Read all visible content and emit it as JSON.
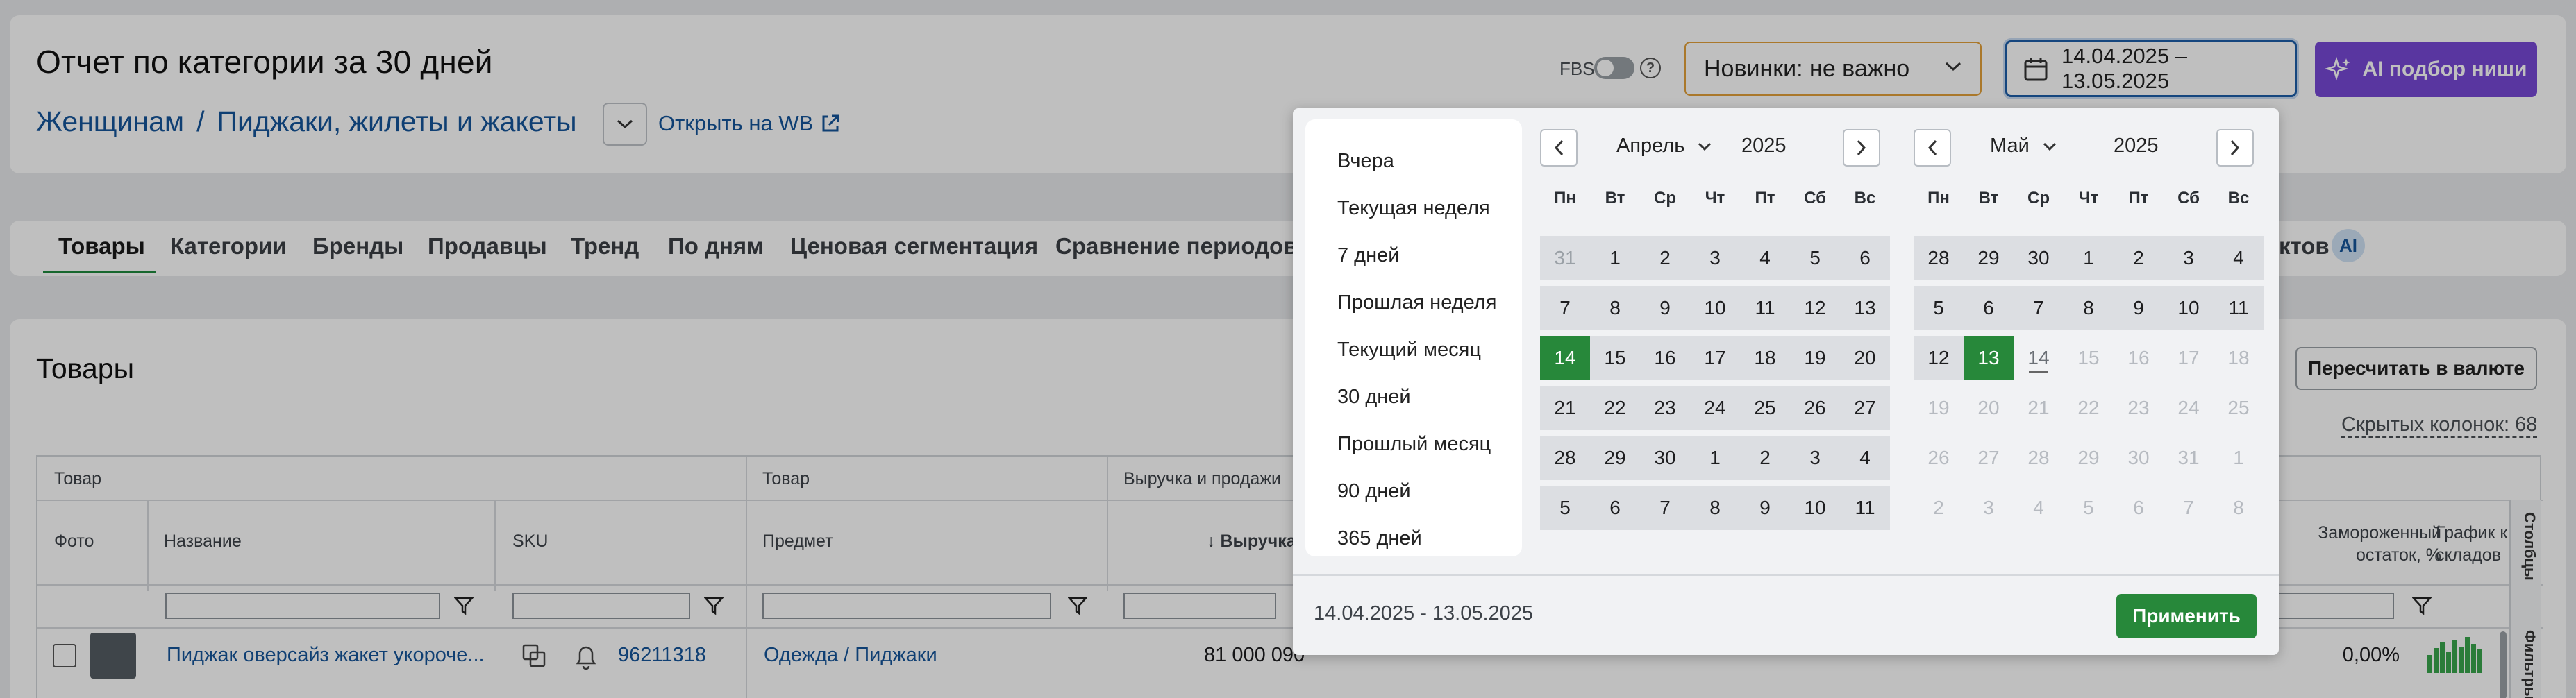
{
  "header": {
    "title": "Отчет по категории за 30 дней",
    "breadcrumb": [
      "Женщинам",
      "Пиджаки, жилеты и жакеты"
    ],
    "breadcrumb_sep": "/",
    "open_wb": "Открыть на WB",
    "fbs_label": "FBS",
    "fbs_help": "?",
    "novinki": "Новинки: не важно",
    "date_range": "14.04.2025 – 13.05.2025",
    "ai_button": "AI подбор ниши"
  },
  "tabs": [
    "Товары",
    "Категории",
    "Бренды",
    "Продавцы",
    "Тренд",
    "По дням",
    "Ценовая сегментация",
    "Сравнение периодов"
  ],
  "tab_overflow": {
    "label": "ктов",
    "badge": "AI"
  },
  "section": {
    "title": "Товары",
    "recalc": "Пересчитать в валюте",
    "hidden_cols": "Скрытых колонок: 68"
  },
  "table": {
    "groups": [
      "Товар",
      "Товар",
      "Выручка и продажи"
    ],
    "columns": [
      "Фото",
      "Название",
      "SKU",
      "Предмет",
      "↓ Выручка"
    ],
    "right_columns": [
      "Замороженный остаток, %",
      "График к складов"
    ],
    "side_tabs": [
      "Столбцы",
      "Фильтры"
    ],
    "row": {
      "name": "Пиджак оверсайз жакет укороче...",
      "sku": "96211318",
      "subject": "Одежда / Пиджаки",
      "revenue": "81 000 090",
      "frozen": "0,00%"
    }
  },
  "date_popup": {
    "presets": [
      "Вчера",
      "Текущая неделя",
      "7 дней",
      "Прошлая неделя",
      "Текущий месяц",
      "30 дней",
      "Прошлый месяц",
      "90 дней",
      "365 дней"
    ],
    "weekdays": [
      "Пн",
      "Вт",
      "Ср",
      "Чт",
      "Пт",
      "Сб",
      "Вс"
    ],
    "left": {
      "month": "Апрель",
      "year": "2025",
      "weeks": [
        [
          "31",
          "1",
          "2",
          "3",
          "4",
          "5",
          "6"
        ],
        [
          "7",
          "8",
          "9",
          "10",
          "11",
          "12",
          "13"
        ],
        [
          "14",
          "15",
          "16",
          "17",
          "18",
          "19",
          "20"
        ],
        [
          "21",
          "22",
          "23",
          "24",
          "25",
          "26",
          "27"
        ],
        [
          "28",
          "29",
          "30",
          "1",
          "2",
          "3",
          "4"
        ],
        [
          "5",
          "6",
          "7",
          "8",
          "9",
          "10",
          "11"
        ]
      ]
    },
    "right": {
      "month": "Май",
      "year": "2025",
      "weeks": [
        [
          "28",
          "29",
          "30",
          "1",
          "2",
          "3",
          "4"
        ],
        [
          "5",
          "6",
          "7",
          "8",
          "9",
          "10",
          "11"
        ],
        [
          "12",
          "13",
          "14",
          "15",
          "16",
          "17",
          "18"
        ],
        [
          "19",
          "20",
          "21",
          "22",
          "23",
          "24",
          "25"
        ],
        [
          "26",
          "27",
          "28",
          "29",
          "30",
          "31",
          "1"
        ],
        [
          "2",
          "3",
          "4",
          "5",
          "6",
          "7",
          "8"
        ]
      ]
    },
    "selected_range_text": "14.04.2025 - 13.05.2025",
    "apply": "Применить"
  },
  "colors": {
    "accent_green": "#27883a",
    "link_blue": "#14549a",
    "ai_purple": "#7749d6",
    "novinki_border": "#e3a03a"
  }
}
